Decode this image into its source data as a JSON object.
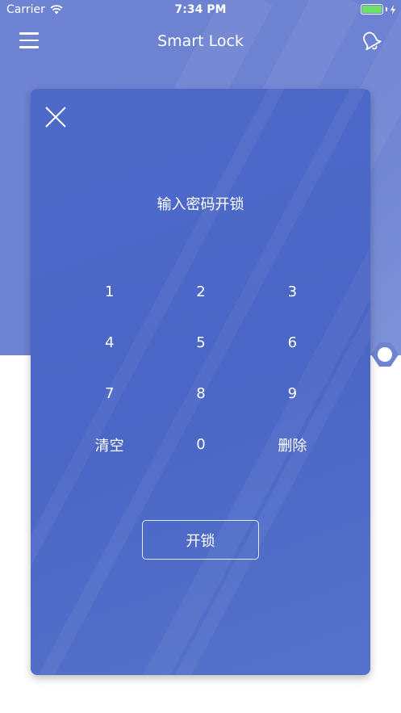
{
  "status_bar": {
    "carrier": "Carrier",
    "time": "7:34 PM",
    "wifi_icon": "wifi-icon",
    "battery_icon": "battery-icon"
  },
  "nav": {
    "title": "Smart Lock",
    "menu_icon": "hamburger-menu-icon",
    "bell_icon": "bell-icon"
  },
  "dialog": {
    "close_icon": "close-icon",
    "prompt": "输入密码开锁",
    "keys": [
      "1",
      "2",
      "3",
      "4",
      "5",
      "6",
      "7",
      "8",
      "9",
      "清空",
      "0",
      "删除"
    ],
    "unlock_label": "开锁"
  },
  "colors": {
    "header_bg": "#6f83d3",
    "panel_bg": "#4e6ac9",
    "text": "#ffffff",
    "battery_fill": "#6fe06a"
  }
}
